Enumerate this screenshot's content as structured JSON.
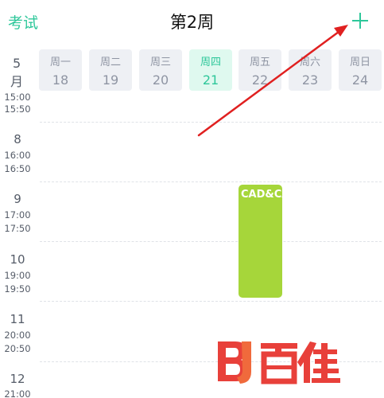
{
  "header": {
    "exam_label": "考试",
    "title": "第2周"
  },
  "month": {
    "number": "5",
    "unit": "月"
  },
  "days": [
    {
      "name": "周一",
      "date": "18"
    },
    {
      "name": "周二",
      "date": "19"
    },
    {
      "name": "周三",
      "date": "20"
    },
    {
      "name": "周四",
      "date": "21",
      "today": true
    },
    {
      "name": "周五",
      "date": "22"
    },
    {
      "name": "周六",
      "date": "23"
    },
    {
      "name": "周日",
      "date": "24"
    }
  ],
  "periods": [
    {
      "end": "15:00"
    },
    {
      "start": "15:50"
    },
    {
      "number": "8",
      "start": "16:00",
      "end": "16:50"
    },
    {
      "number": "9",
      "start": "17:00",
      "end": "17:50"
    },
    {
      "number": "10",
      "start": "19:00",
      "end": "19:50"
    },
    {
      "number": "11",
      "start": "20:00",
      "end": "20:50"
    },
    {
      "number": "12",
      "start": "21:00"
    }
  ],
  "course": {
    "name": "CAD&CAM",
    "color": "#a6d63a"
  },
  "colors": {
    "accent": "#2ec79a",
    "annotation": "#e02020"
  },
  "watermark": {
    "text": "百佳",
    "logo": "BJ"
  }
}
